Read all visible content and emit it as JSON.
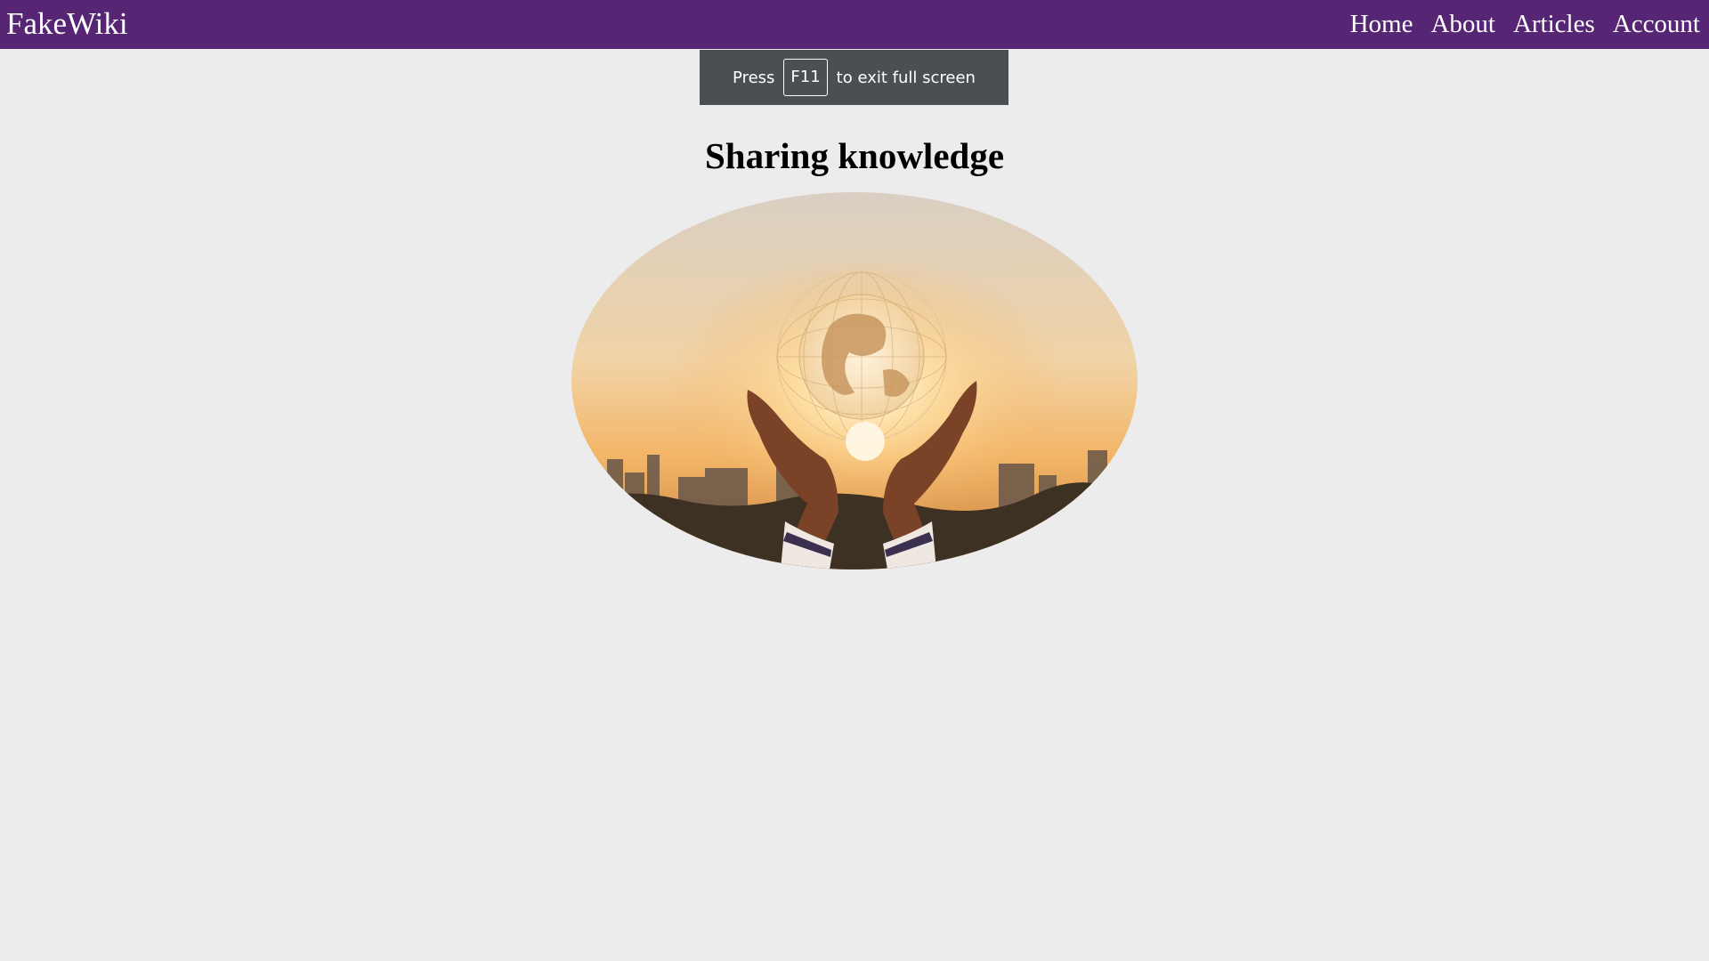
{
  "navbar": {
    "brand": "FakeWiki",
    "links": [
      {
        "label": "Home"
      },
      {
        "label": "About"
      },
      {
        "label": "Articles"
      },
      {
        "label": "Account"
      }
    ],
    "background_color": "#562674"
  },
  "fullscreen_notice": {
    "before": "Press",
    "key": "F11",
    "after": "to exit full screen"
  },
  "main": {
    "title": "Sharing knowledge",
    "image_subject": "hands holding glowing globe over city skyline at sunset"
  },
  "colors": {
    "page_background": "#ececec",
    "toast_background": "#4b4f54"
  }
}
